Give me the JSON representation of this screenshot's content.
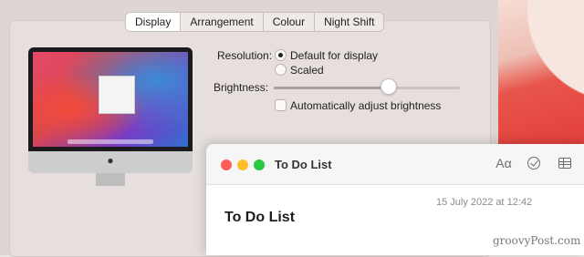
{
  "display_settings": {
    "tabs": [
      {
        "label": "Display",
        "active": true
      },
      {
        "label": "Arrangement",
        "active": false
      },
      {
        "label": "Colour",
        "active": false
      },
      {
        "label": "Night Shift",
        "active": false
      }
    ],
    "resolution": {
      "label": "Resolution:",
      "options": [
        {
          "label": "Default for display",
          "selected": true
        },
        {
          "label": "Scaled",
          "selected": false
        }
      ]
    },
    "brightness": {
      "label": "Brightness:",
      "value_percent": 62
    },
    "auto_brightness": {
      "label": "Automatically adjust brightness",
      "checked": false
    }
  },
  "notes_window": {
    "title": "To Do List",
    "toolbar": {
      "font_button_glyph": "Aα",
      "icons": [
        "format-font-icon",
        "checklist-icon",
        "table-icon"
      ]
    },
    "date": "15 July 2022 at 12:42",
    "heading": "To Do List"
  },
  "watermark": "groovyPost.com",
  "colors": {
    "close": "#fc5f57",
    "minimize": "#fdbc2e",
    "zoom": "#28c840"
  }
}
